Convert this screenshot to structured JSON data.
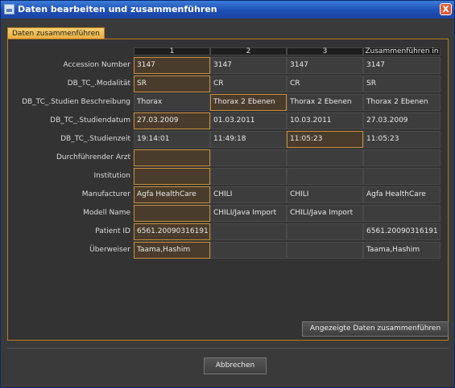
{
  "window": {
    "title": "Daten bearbeiten und zusammenführen",
    "close_glyph": "X",
    "app_icon": "window-app-icon"
  },
  "tab": {
    "label": "Daten zusammenführen"
  },
  "columns": [
    "1",
    "2",
    "3",
    "Zusammenführen in"
  ],
  "rows": [
    {
      "label": "Accession Number",
      "cells": [
        "3147",
        "3147",
        "3147",
        "3147"
      ],
      "selected": 0
    },
    {
      "label": "DB_TC_.Modalität",
      "cells": [
        "SR",
        "CR",
        "CR",
        "SR"
      ],
      "selected": 0
    },
    {
      "label": "DB_TC_.Studien Beschreibung",
      "cells": [
        "Thorax",
        "Thorax 2 Ebenen",
        "Thorax 2 Ebenen",
        "Thorax 2 Ebenen"
      ],
      "selected": 1
    },
    {
      "label": "DB_TC_.Studiendatum",
      "cells": [
        "27.03.2009",
        "01.03.2011",
        "10.03.2011",
        "27.03.2009"
      ],
      "selected": 0
    },
    {
      "label": "DB_TC_.Studienzeit",
      "cells": [
        "19:14:01",
        "11:49:18",
        "11:05:23",
        "11:05:23"
      ],
      "selected": 2
    },
    {
      "label": "Durchführender Arzt",
      "cells": [
        "",
        "",
        "",
        ""
      ],
      "selected": 0
    },
    {
      "label": "Institution",
      "cells": [
        "",
        "",
        "",
        ""
      ],
      "selected": 0
    },
    {
      "label": "Manufacturer",
      "cells": [
        "Agfa HealthCare",
        "CHILI",
        "CHILI",
        "Agfa HealthCare"
      ],
      "selected": 0
    },
    {
      "label": "Modell Name",
      "cells": [
        "",
        "CHILI/Java Import",
        "CHILI/Java Import",
        ""
      ],
      "selected": 0
    },
    {
      "label": "Patient ID",
      "cells": [
        "6561.20090316191",
        "",
        "",
        "6561.20090316191"
      ],
      "selected": 0
    },
    {
      "label": "Überweiser",
      "cells": [
        "Taama,Hashim",
        "",
        "",
        "Taama,Hashim"
      ],
      "selected": 0
    }
  ],
  "buttons": {
    "merge": "Angezeigte Daten zusammenführen",
    "cancel": "Abbrechen"
  },
  "colors": {
    "selected_border": "#c8903c",
    "title_bar": "#1f4fb4",
    "tab": "#e7a93a"
  }
}
